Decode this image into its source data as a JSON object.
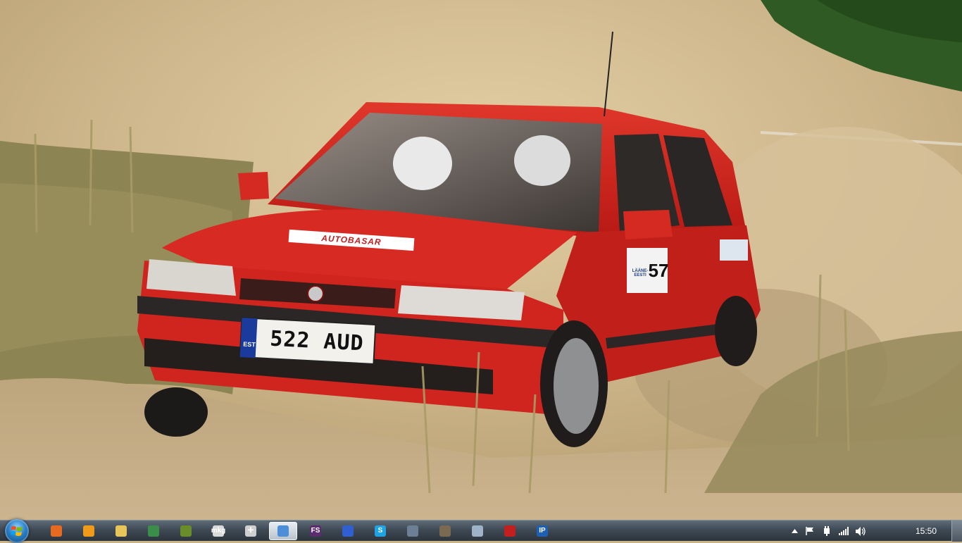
{
  "wallpaper": {
    "subject": "red-rally-hatchback-in-dust",
    "license_plate": "522 AUD",
    "plate_country": "EST",
    "sponsor_banner": "AUTOBASAR",
    "door_number": "57",
    "door_decal": "LÄÄNE-EESTI",
    "colors": {
      "car_red": "#d8231f",
      "dust": "#c9b48a",
      "grass": "#8c8452",
      "trees": "#2f5a23"
    }
  },
  "taskbar": {
    "start_icon": "windows-logo-icon",
    "pinned": [
      {
        "name": "firefox-icon",
        "color": "#e66a1f",
        "label": ""
      },
      {
        "name": "media-player-icon",
        "color": "#f09a19",
        "label": ""
      },
      {
        "name": "file-explorer-icon",
        "color": "#e7c55a",
        "label": ""
      },
      {
        "name": "system-monitor-icon",
        "color": "#3b8e4a",
        "label": ""
      },
      {
        "name": "game-app-icon",
        "color": "#6a8d2b",
        "label": ""
      },
      {
        "name": "mkg-app-icon",
        "color": "#d9d9d9",
        "label": "mkg"
      },
      {
        "name": "crosshair-app-icon",
        "color": "#cfcfcf",
        "label": "✛"
      },
      {
        "name": "network-people-icon",
        "color": "#4c8fd6",
        "label": ""
      },
      {
        "name": "fs-app-icon",
        "color": "#5b2c6f",
        "label": "FS"
      },
      {
        "name": "globe-app-icon",
        "color": "#2f5fd0",
        "label": ""
      },
      {
        "name": "skype-icon",
        "color": "#1fa3e4",
        "label": "S"
      },
      {
        "name": "sound-app-icon",
        "color": "#6c7f95",
        "label": ""
      },
      {
        "name": "gimp-icon",
        "color": "#7a6a52",
        "label": ""
      },
      {
        "name": "calculator-icon",
        "color": "#9fb3c8",
        "label": ""
      },
      {
        "name": "pdf-reader-icon",
        "color": "#c21f1f",
        "label": ""
      },
      {
        "name": "ip-app-icon",
        "color": "#1e5fb3",
        "label": "IP"
      }
    ],
    "active_index": 7,
    "tray": {
      "show_hidden_icon": "chevron-up-icon",
      "flag_icon": "action-center-flag-icon",
      "power_icon": "power-plug-icon",
      "network_icon": "signal-bars-icon",
      "volume_icon": "speaker-icon",
      "clock": "15:50"
    }
  }
}
